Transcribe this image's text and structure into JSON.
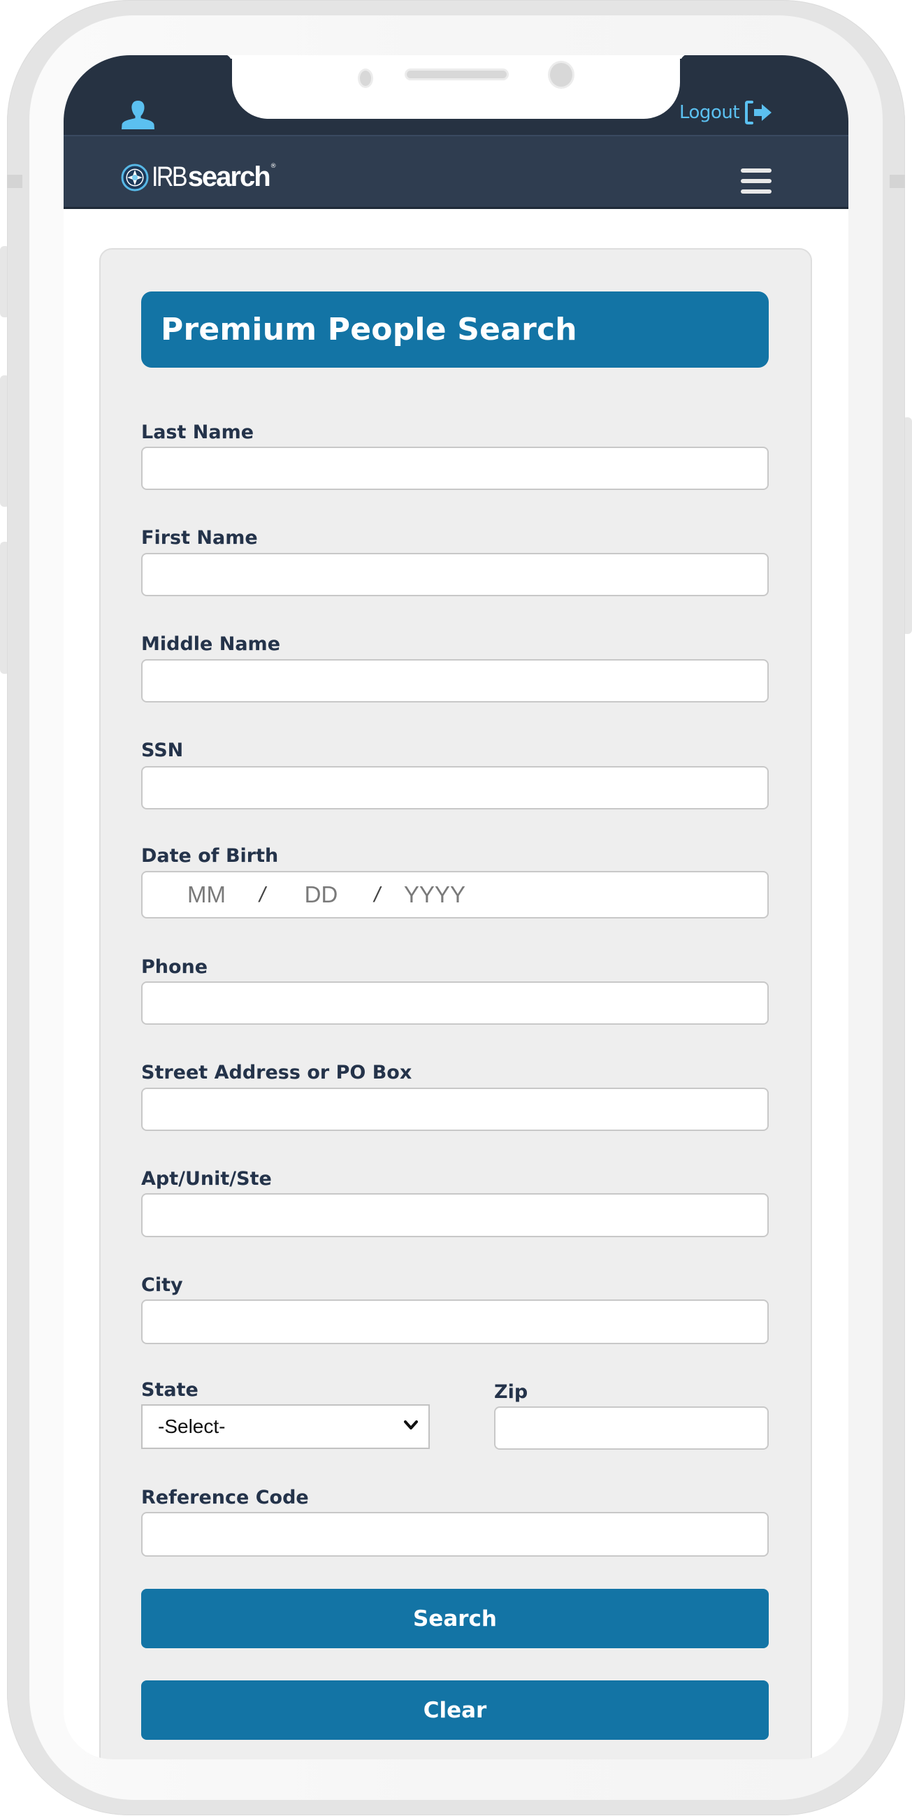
{
  "header": {
    "user_icon": "user-icon",
    "logout_label": "Logout",
    "logout_icon": "sign-out-icon",
    "colors": {
      "topbar": "#263242",
      "navbar": "#2f3d50",
      "accent_light": "#5bc0f0"
    }
  },
  "nav": {
    "logo_prefix": "IRB",
    "logo_suffix": "search",
    "logo_registered": "®",
    "menu_icon": "hamburger-menu-icon"
  },
  "form": {
    "title": "Premium People Search",
    "accent_color": "#1374a5",
    "fields": {
      "last_name": {
        "label": "Last Name",
        "value": ""
      },
      "first_name": {
        "label": "First Name",
        "value": ""
      },
      "middle_name": {
        "label": "Middle Name",
        "value": ""
      },
      "ssn": {
        "label": "SSN",
        "value": ""
      },
      "dob": {
        "label": "Date of Birth",
        "month_placeholder": "MM",
        "day_placeholder": "DD",
        "year_placeholder": "YYYY",
        "separator": "/"
      },
      "phone": {
        "label": "Phone",
        "value": ""
      },
      "street": {
        "label": "Street Address or PO Box",
        "value": ""
      },
      "apt": {
        "label": "Apt/Unit/Ste",
        "value": ""
      },
      "city": {
        "label": "City",
        "value": ""
      },
      "state": {
        "label": "State",
        "selected": "-Select-"
      },
      "zip": {
        "label": "Zip",
        "value": ""
      },
      "reference_code": {
        "label": "Reference Code",
        "value": ""
      }
    },
    "buttons": {
      "search": "Search",
      "clear": "Clear"
    }
  }
}
